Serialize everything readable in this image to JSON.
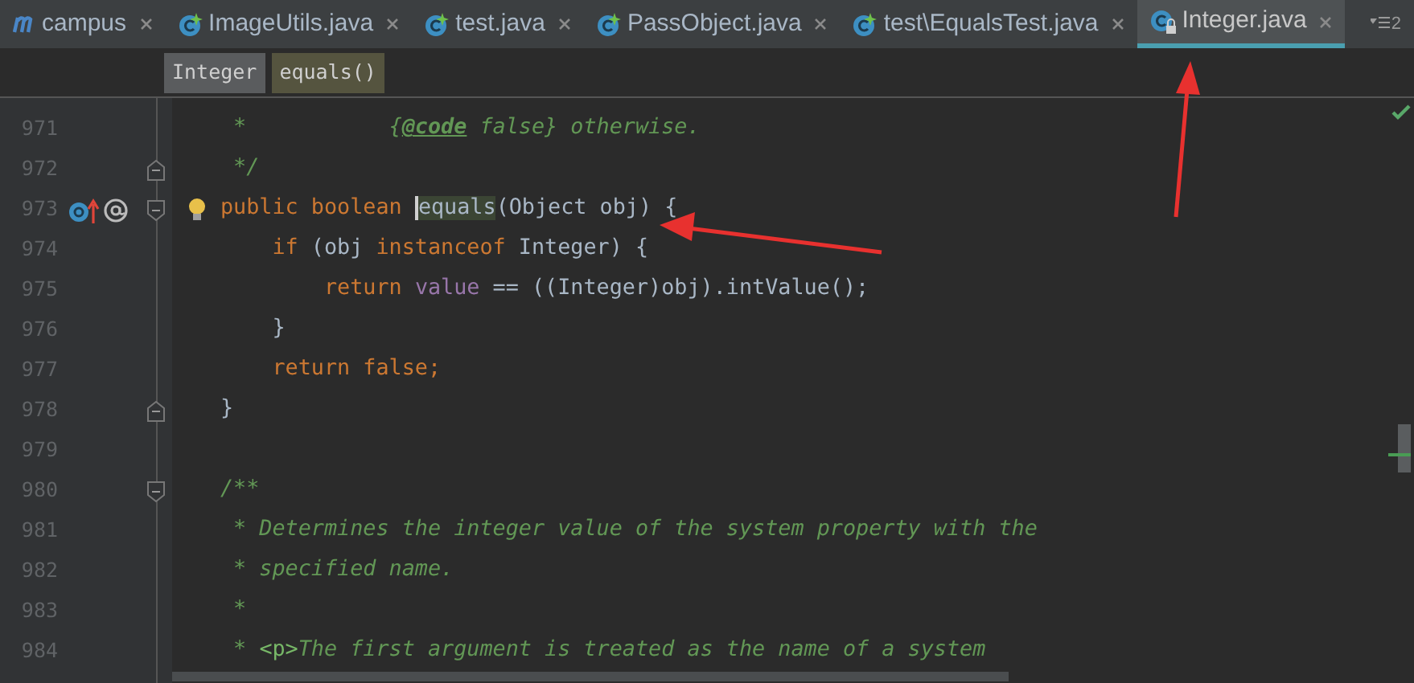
{
  "tabs": [
    {
      "label": "campus",
      "kind": "module",
      "selected": false
    },
    {
      "label": "ImageUtils.java",
      "kind": "class",
      "selected": false
    },
    {
      "label": "test.java",
      "kind": "class",
      "selected": false
    },
    {
      "label": "PassObject.java",
      "kind": "class",
      "selected": false
    },
    {
      "label": "test\\EqualsTest.java",
      "kind": "class",
      "selected": false
    },
    {
      "label": "Integer.java",
      "kind": "readonly-class",
      "selected": true
    }
  ],
  "hidden_tabs_count": "2",
  "breadcrumbs": [
    {
      "label": "Integer",
      "selected": false
    },
    {
      "label": "equals()",
      "selected": true
    }
  ],
  "lines": [
    {
      "number": "971",
      "tokens": [
        {
          "kind": "doc",
          "text": " *           "
        },
        {
          "kind": "doc",
          "text": "{"
        },
        {
          "kind": "doctag",
          "text": "@code"
        },
        {
          "kind": "doc",
          "text": " false} otherwise."
        }
      ]
    },
    {
      "number": "972",
      "fold_end": true,
      "tokens": [
        {
          "kind": "doc",
          "text": " */"
        }
      ]
    },
    {
      "number": "973",
      "fold_start": true,
      "gutter_marks": true,
      "intention": true,
      "tokens": [
        {
          "kind": "keyword",
          "text": "public boolean "
        },
        {
          "kind": "plain",
          "text": "equals",
          "highlighted": true,
          "caret": true
        },
        {
          "kind": "plain",
          "text": "(Object obj) {"
        }
      ]
    },
    {
      "number": "974",
      "tokens": [
        {
          "kind": "keyword",
          "text": "    if"
        },
        {
          "kind": "plain",
          "text": " (obj "
        },
        {
          "kind": "keyword",
          "text": "instanceof"
        },
        {
          "kind": "plain",
          "text": " Integer) {"
        }
      ]
    },
    {
      "number": "975",
      "tokens": [
        {
          "kind": "keyword",
          "text": "        return "
        },
        {
          "kind": "field",
          "text": "value"
        },
        {
          "kind": "plain",
          "text": " == ((Integer)obj).intValue();"
        }
      ]
    },
    {
      "number": "976",
      "tokens": [
        {
          "kind": "plain",
          "text": "    }"
        }
      ]
    },
    {
      "number": "977",
      "tokens": [
        {
          "kind": "keyword",
          "text": "    return false;"
        }
      ]
    },
    {
      "number": "978",
      "fold_end": true,
      "tokens": [
        {
          "kind": "plain",
          "text": "}"
        }
      ]
    },
    {
      "number": "979"
    },
    {
      "number": "980",
      "fold_start": true,
      "tokens": [
        {
          "kind": "doc",
          "text": "/**"
        }
      ]
    },
    {
      "number": "981",
      "tokens": [
        {
          "kind": "doc",
          "text": " * Determines the integer value of the system property with the"
        }
      ]
    },
    {
      "number": "982",
      "tokens": [
        {
          "kind": "doc",
          "text": " * specified name."
        }
      ]
    },
    {
      "number": "983",
      "tokens": [
        {
          "kind": "doc",
          "text": " *"
        }
      ]
    },
    {
      "number": "984",
      "tokens": [
        {
          "kind": "doc",
          "text": " * "
        },
        {
          "kind": "markup",
          "text": "<p>"
        },
        {
          "kind": "doc",
          "text": "The first argument is treated as the name of a system"
        }
      ]
    }
  ]
}
